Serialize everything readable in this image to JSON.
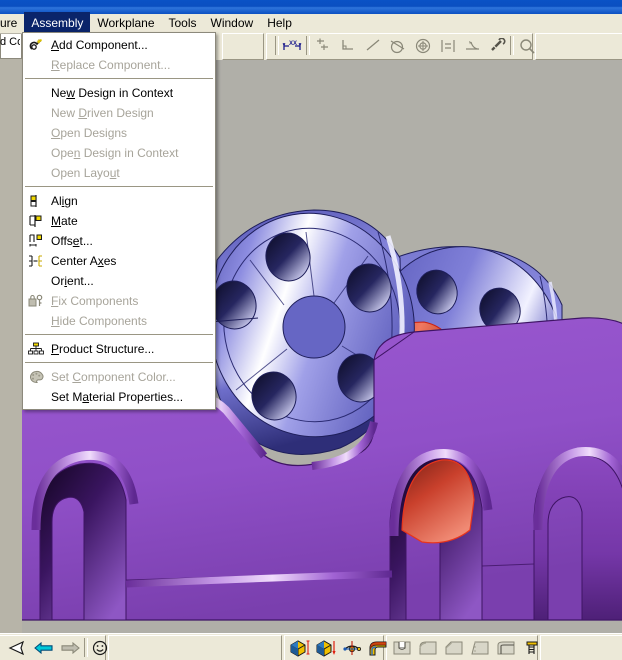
{
  "window": {
    "titlebar_color": "#0A4FC0",
    "chrome_color": "#ECE9D8",
    "viewport_color": "#B0AFA8"
  },
  "menubar": {
    "items": [
      {
        "label": "ure",
        "active": false,
        "clipped": true
      },
      {
        "label": "Assembly",
        "active": true,
        "clipped": false
      },
      {
        "label": "Workplane",
        "active": false,
        "clipped": false
      },
      {
        "label": "Tools",
        "active": false,
        "clipped": false
      },
      {
        "label": "Window",
        "active": false,
        "clipped": false
      },
      {
        "label": "Help",
        "active": false,
        "clipped": false
      }
    ]
  },
  "left_panel": {
    "clipped_label": "d Co"
  },
  "dropdown": {
    "title": "Assembly",
    "groups": [
      {
        "items": [
          {
            "label": "Add Component...",
            "accel": "A",
            "enabled": true,
            "icon": "add-component-icon"
          },
          {
            "label": "Replace Component...",
            "accel": "R",
            "enabled": false,
            "icon": "none"
          }
        ]
      },
      {
        "items": [
          {
            "label": "New Design in Context",
            "accel": "w",
            "enabled": true,
            "icon": "none"
          },
          {
            "label": "New Driven Design",
            "accel": "D",
            "enabled": false,
            "icon": "none"
          },
          {
            "label": "Open Designs",
            "accel": "O",
            "enabled": false,
            "icon": "none"
          },
          {
            "label": "Open Design in Context",
            "accel": "n",
            "enabled": false,
            "icon": "none"
          },
          {
            "label": "Open Layout",
            "accel": "u",
            "enabled": false,
            "icon": "none"
          }
        ]
      },
      {
        "items": [
          {
            "label": "Align",
            "accel": "i",
            "enabled": true,
            "icon": "align-icon"
          },
          {
            "label": "Mate",
            "accel": "M",
            "enabled": true,
            "icon": "mate-icon"
          },
          {
            "label": "Offset...",
            "accel": "e",
            "enabled": true,
            "icon": "offset-icon"
          },
          {
            "label": "Center Axes",
            "accel": "x",
            "enabled": true,
            "icon": "center-axes-icon"
          },
          {
            "label": "Orient...",
            "accel": "i",
            "enabled": true,
            "icon": "none"
          },
          {
            "label": "Fix Components",
            "accel": "F",
            "enabled": false,
            "icon": "lock-key-icon"
          },
          {
            "label": "Hide Components",
            "accel": "H",
            "enabled": false,
            "icon": "none"
          }
        ]
      },
      {
        "items": [
          {
            "label": "Product Structure...",
            "accel": "P",
            "enabled": true,
            "icon": "product-structure-icon"
          }
        ]
      },
      {
        "items": [
          {
            "label": "Set Component Color...",
            "accel": "C",
            "enabled": false,
            "icon": "palette-icon"
          },
          {
            "label": "Set Material Properties...",
            "accel": "a",
            "enabled": true,
            "icon": "none"
          }
        ]
      }
    ]
  },
  "toolbar": {
    "icons": [
      {
        "name": "dimension-xx-icon",
        "enabled": true
      },
      {
        "name": "parallel-constraint-icon",
        "enabled": false
      },
      {
        "name": "perpendicular-constraint-icon",
        "enabled": false
      },
      {
        "name": "collinear-constraint-icon",
        "enabled": false
      },
      {
        "name": "tangent-constraint-icon",
        "enabled": false
      },
      {
        "name": "concentric-constraint-icon",
        "enabled": false
      },
      {
        "name": "equal-length-constraint-icon",
        "enabled": false
      },
      {
        "name": "symmetric-constraint-icon",
        "enabled": false
      },
      {
        "name": "fix-constraint-icon",
        "enabled": false
      },
      {
        "name": "inspect-constraint-icon",
        "enabled": false
      }
    ]
  },
  "bottom_toolbar": {
    "left_icons": [
      {
        "name": "cursor-arrow-icon"
      },
      {
        "name": "previous-view-icon"
      },
      {
        "name": "next-view-icon"
      },
      {
        "name": "smiley-face-icon"
      }
    ],
    "right_icons": [
      {
        "name": "extrude-protrusion-icon"
      },
      {
        "name": "extrude-cutout-icon"
      },
      {
        "name": "revolve-icon"
      },
      {
        "name": "sweep-icon"
      },
      {
        "name": "hole-feature-icon"
      },
      {
        "name": "round-feature-icon"
      },
      {
        "name": "chamfer-feature-icon"
      },
      {
        "name": "draft-feature-icon"
      },
      {
        "name": "shell-feature-icon"
      },
      {
        "name": "thread-feature-icon"
      }
    ]
  },
  "model": {
    "description": "3D assembly of two flanged hubs with bolt holes joined by a shaft, above a bracket plate",
    "colors": {
      "hub_body": "#6B6BC0",
      "hub_light": "#C8C8F0",
      "hub_edge": "#202060",
      "shaft_highlight": "#E8503C",
      "bracket": "#9B59D0",
      "bracket_light": "#E0BFF5",
      "bracket_edge": "#4A1E70",
      "background": "#B0AFA8"
    }
  }
}
